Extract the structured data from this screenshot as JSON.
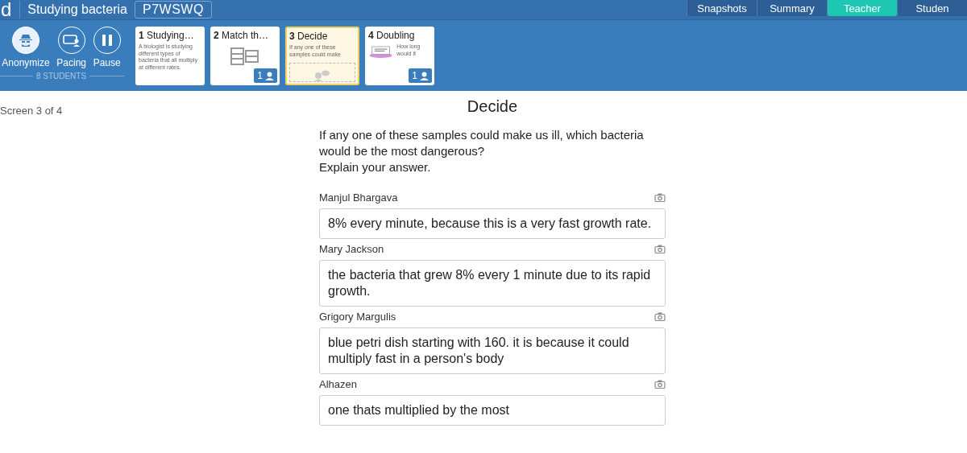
{
  "header": {
    "logo": "d",
    "title": "Studying bacteria",
    "code": "P7WSWQ"
  },
  "tabs": [
    {
      "label": "Snapshots",
      "selected": false
    },
    {
      "label": "Summary",
      "selected": false
    },
    {
      "label": "Teacher",
      "selected": true
    },
    {
      "label": "Studen",
      "selected": false
    }
  ],
  "controls": [
    {
      "label": "Anonymize",
      "kind": "anonymize",
      "on": true
    },
    {
      "label": "Pacing",
      "kind": "pacing",
      "on": false
    },
    {
      "label": "Pause",
      "kind": "pause",
      "on": false
    }
  ],
  "student_count": "8 STUDENTS",
  "screens": [
    {
      "number": "1",
      "title": "Studying…",
      "kind": "text",
      "description": "A biologist is studying different types of bacteria that all multiply at different rates.",
      "selected": false
    },
    {
      "number": "2",
      "title": "Match th…",
      "kind": "table",
      "badge": "1",
      "selected": false
    },
    {
      "number": "3",
      "title": "Decide",
      "kind": "question",
      "description": "If any one of these samples could make",
      "selected": true
    },
    {
      "number": "4",
      "title": "Doubling",
      "kind": "picture",
      "description": "How long would it",
      "badge": "1",
      "selected": false
    }
  ],
  "screen_position": "Screen 3 of 4",
  "question": {
    "title": "Decide",
    "prompt": "If any one of these samples could make us ill, which bacteria would be the most dangerous?",
    "instruction": "Explain your answer."
  },
  "responses": [
    {
      "student": "Manjul Bhargava",
      "answer": "8% every minute, because this is a very fast growth rate."
    },
    {
      "student": "Mary Jackson",
      "answer": "the bacteria that grew 8% every 1 minute due to its rapid growth."
    },
    {
      "student": "Grigory Margulis",
      "answer": "blue petri dish starting with 160. it is because it could multiply fast in a person's body"
    },
    {
      "student": "Alhazen",
      "answer": "one thats multiplied by the most"
    }
  ]
}
